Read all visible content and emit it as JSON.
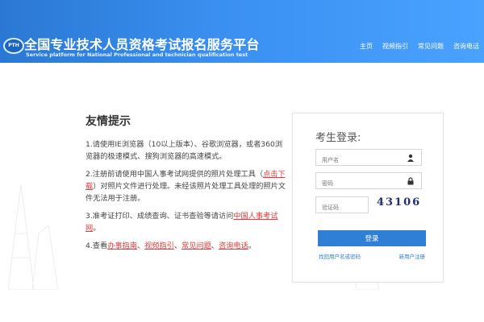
{
  "header": {
    "logo_text": "PTH",
    "title_cn": "全国专业技术人员资格考试报名服务平台",
    "title_en": "Service platform for National Professional and technician qualification test",
    "nav": [
      "主页",
      "视频指引",
      "常见问题",
      "咨询电话"
    ]
  },
  "tips": {
    "title": "友情提示",
    "item1": "1.请使用IE浏览器（10以上版本）、谷歌浏览器，或者360浏览器的极速模式、搜狗浏览器的高速模式。",
    "item2_a": "2.注册前请使用中国人事考试网提供的照片处理工具（",
    "item2_link": "点击下载",
    "item2_b": "）对照片文件进行处理。未经该照片处理工具处理的照片文件无法用于注册。",
    "item3_a": "3.准考证打印、成绩查询、证书查验等请访问",
    "item3_link": "中国人事考试网",
    "item3_b": "。",
    "item4_a": "4.查看",
    "item4_links": [
      "办事指南",
      "视频指引",
      "常见问题",
      "咨询电话"
    ],
    "item4_end": "。"
  },
  "login": {
    "title": "考生登录:",
    "username_placeholder": "用户名",
    "password_placeholder": "密码",
    "captcha_placeholder": "验证码",
    "captcha_text": "43106",
    "login_button": "登录",
    "forgot_link": "找回用户名或密码",
    "register_link": "新用户注册"
  },
  "colors": {
    "header_blue": "#3a8ff0",
    "button_blue": "#2f7fd6",
    "link_red": "#e23a3a"
  }
}
